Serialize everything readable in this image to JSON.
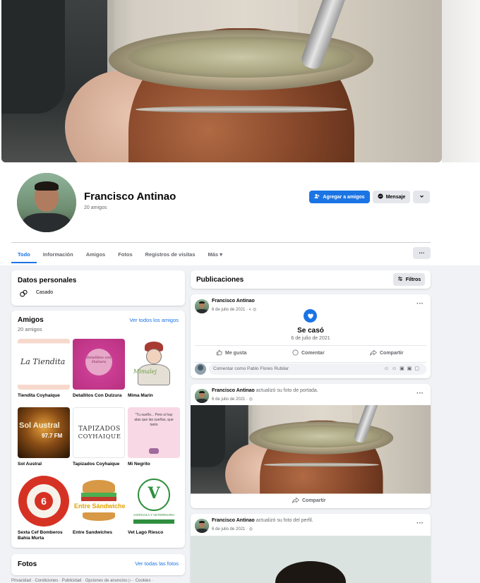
{
  "profile": {
    "name": "Francisco Antinao",
    "friends_count": "20 amigos",
    "add_friend_label": "Agregar a amigos",
    "message_label": "Mensaje"
  },
  "tabs": [
    {
      "label": "Todo"
    },
    {
      "label": "Información"
    },
    {
      "label": "Amigos"
    },
    {
      "label": "Fotos"
    },
    {
      "label": "Registros de visitas"
    },
    {
      "label": "Más ▾"
    }
  ],
  "personal": {
    "title": "Datos personales",
    "status": "Casado"
  },
  "friends": {
    "title": "Amigos",
    "count": "20 amigos",
    "see_all": "Ver todos los amigos",
    "items": [
      {
        "name": "Tiendita Coyhaique",
        "img_text": "La Tiendita"
      },
      {
        "name": "Detallitos Con Dulzura",
        "img_text": "Detallitos con Dulzura"
      },
      {
        "name": "Mima Marin",
        "img_text": "Mimalej"
      },
      {
        "name": "Sol Austral",
        "img_text": "Sol Austral",
        "img_subtext": "97.7 FM"
      },
      {
        "name": "Tapizados Coyhaique",
        "img_text": "TAPIZADOS",
        "img_subtext": "COYHAIQUE"
      },
      {
        "name": "Mi Negrito",
        "img_text": "\"Tu sueño... Pero si hay alas que las sueñas, que tanto"
      },
      {
        "name": "Sexta Cef Bomberos Bahía Murta",
        "img_text": "6"
      },
      {
        "name": "Entre Sandwiches",
        "img_text": "Entre Sándwiches"
      },
      {
        "name": "Vet Lago Riesco",
        "img_text": "V",
        "img_subtext": "AGRICOLA Y VETERINARIA"
      }
    ]
  },
  "photos": {
    "title": "Fotos",
    "see_all": "Ver todas las fotos"
  },
  "footer": "Privacidad · Condiciones · Publicidad · Opciones de anuncios ▷ · Cookies ·",
  "posts": {
    "title": "Publicaciones",
    "filters_label": "Filtros",
    "items": [
      {
        "author": "Francisco Antinao",
        "action": "",
        "date": "6 de julio de 2021 ·",
        "event_title": "Se casó",
        "event_date": "6 de julio de 2021",
        "like": "Me gusta",
        "comment": "Comentar",
        "share": "Compartir",
        "comment_placeholder": "Comentar como Pablo Flores Rubilar"
      },
      {
        "author": "Francisco Antinao",
        "action": "actualizó su foto de portada.",
        "date": "6 de julio de 2021 ·",
        "share": "Compartir"
      },
      {
        "author": "Francisco Antinao",
        "action": "actualizó su foto del perfil.",
        "date": "6 de julio de 2021 ·"
      }
    ]
  },
  "colors": {
    "accent": "#1b74e4",
    "background": "#f0f2f5"
  }
}
